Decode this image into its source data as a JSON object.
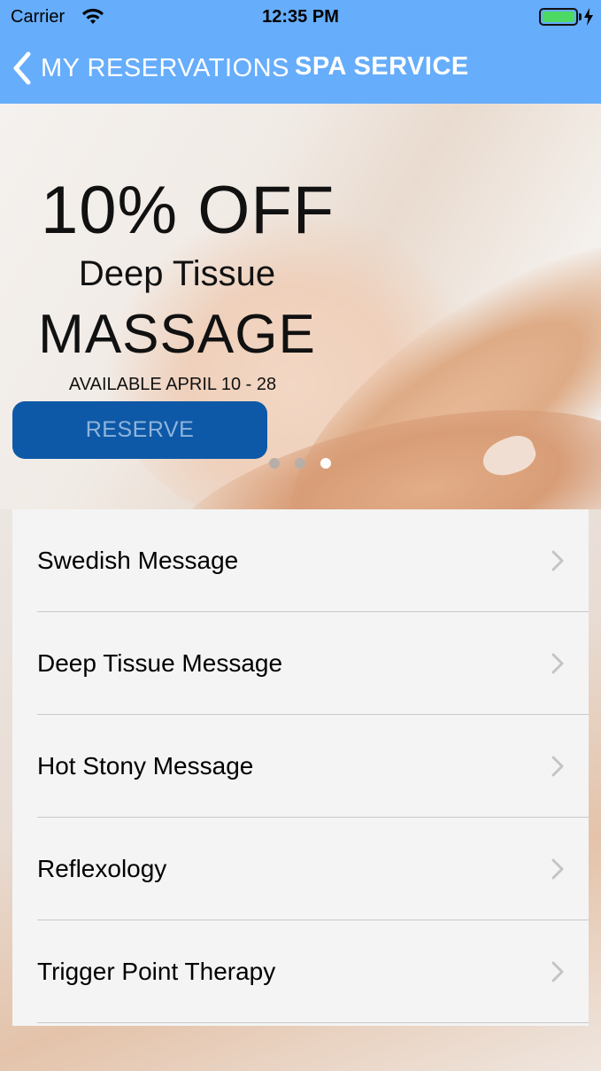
{
  "status_bar": {
    "carrier": "Carrier",
    "time": "12:35 PM",
    "battery_color": "#4cd964"
  },
  "nav": {
    "back_label": "MY RESERVATIONS",
    "title": "SPA SERVICE",
    "color": "#66adfb"
  },
  "promo": {
    "discount": "10% OFF",
    "subtitle": "Deep Tissue",
    "headline": "MASSAGE",
    "availability": "AVAILABLE APRIL 10 - 28",
    "reserve_label": "RESERVE",
    "button_color": "#0e59a7",
    "page_count": 3,
    "active_page": 3
  },
  "services": [
    {
      "label": "Swedish Message"
    },
    {
      "label": "Deep Tissue Message"
    },
    {
      "label": "Hot Stony Message"
    },
    {
      "label": "Reflexology"
    },
    {
      "label": "Trigger Point Therapy"
    }
  ]
}
